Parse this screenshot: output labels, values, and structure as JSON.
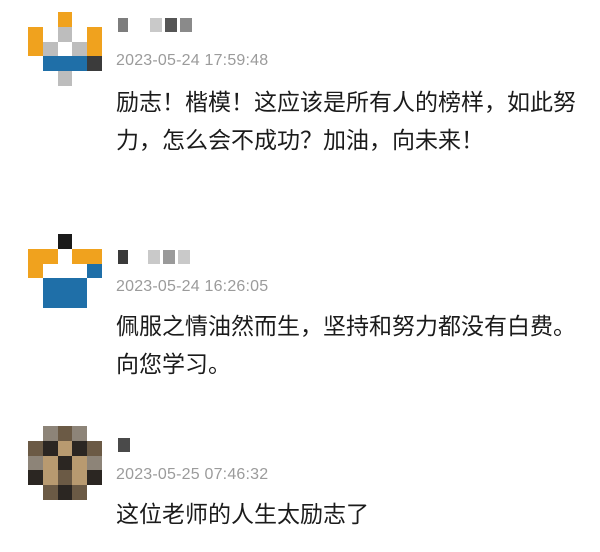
{
  "comments": [
    {
      "timestamp": "2023-05-24 17:59:48",
      "text": "励志！楷模！这应该是所有人的榜样，如此努力，怎么会不成功？加油，向未来！",
      "username": "",
      "avatar_colors": {
        "orange": "#f0a21e",
        "gray": "#bdbdbd",
        "blue": "#1f6fa8",
        "dark": "#3b3b3b"
      }
    },
    {
      "timestamp": "2023-05-24 16:26:05",
      "text": "佩服之情油然而生，坚持和努力都没有白费。向您学习。",
      "username": "",
      "avatar_colors": {
        "orange": "#f0a21e",
        "gray": "#bdbdbd",
        "blue": "#1f6fa8",
        "dark": "#1a1a1a"
      }
    },
    {
      "timestamp": "2023-05-25 07:46:32",
      "text": "这位老师的人生太励志了",
      "username": "",
      "avatar_colors": {
        "brown": "#6b5a45",
        "dark": "#2b2622",
        "tan": "#b89a70",
        "gray": "#8d8478"
      }
    }
  ]
}
